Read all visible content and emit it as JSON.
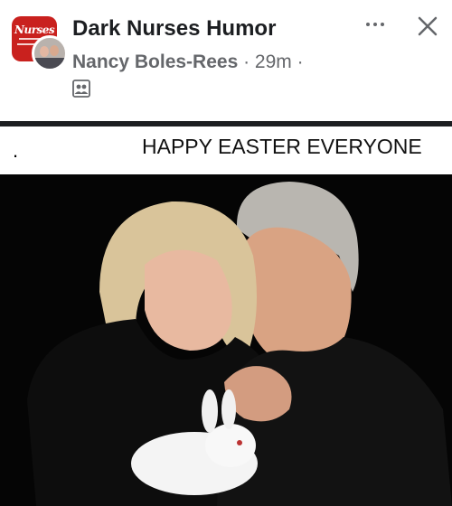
{
  "group": {
    "name": "Dark Nurses Humor",
    "avatar_text": "Nurses",
    "brand_color": "#c9211e"
  },
  "post": {
    "author": "Nancy Boles-Rees",
    "separator1": " · ",
    "time": "29m",
    "separator2": " ·",
    "privacy_icon": "group-members-icon"
  },
  "actions": {
    "more_icon": "more-options-icon",
    "close_icon": "close-icon"
  },
  "caption": {
    "dot": ".",
    "text": "HAPPY EASTER EVERYONE"
  },
  "colors": {
    "text_primary": "#1c1e21",
    "text_secondary": "#65676b",
    "photo_background": "#050505"
  }
}
